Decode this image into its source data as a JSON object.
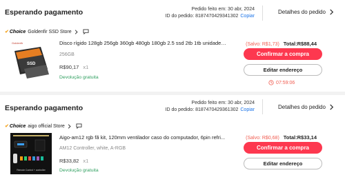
{
  "orders": [
    {
      "status": "Esperando pagamento",
      "date": "Pedido feito em: 30 abr, 2024",
      "order_id": "ID do pedido: 8187470429341302",
      "copy": "Copiar",
      "details": "Detalhes do pedido",
      "choice": "Choice",
      "store": "Goldenfir SSD Store",
      "product_title": "Disco rígido 128gb 256gb 360gb 480gb 180gb 2.5 ssd 2tb 1tb unidades ...",
      "variant": "256GB",
      "price": "R$90,17",
      "qty": "x1",
      "free_return": "Devolução gratuita",
      "saved": "(Salvo: R$1,73)",
      "total": "Total:R$88,44",
      "confirm": "Confirmar a compra",
      "edit_address": "Editar endereço",
      "timer": "07:59:06"
    },
    {
      "status": "Esperando pagamento",
      "date": "Pedido feito em: 30 abr, 2024",
      "order_id": "ID do pedido: 8187470429361302",
      "copy": "Copiar",
      "details": "Detalhes do pedido",
      "choice": "Choice",
      "store": "aigo official Store",
      "product_title": "Aigo-am12 rgb fã kit, 120mm ventilador caso do computador, 6pin refri...",
      "variant": "AM12 Controller, white, A-RGB",
      "price": "R$33,82",
      "qty": "x1",
      "free_return": "Devolução gratuita",
      "saved": "(Salvo: R$0,68)",
      "total": "Total:R$33,14",
      "confirm": "Confirmar a compra",
      "edit_address": "Editar endereço"
    }
  ],
  "thumb1": {
    "brand": "Goldenfir",
    "label": "SSD"
  },
  "thumb2": {
    "caption": "Remote Control + controller"
  },
  "colors": {
    "accent": "#fd384f",
    "saved": "#f05b4f",
    "return": "#2e9e5e",
    "link": "#1a73e8",
    "choice_check": "#f5a623"
  }
}
